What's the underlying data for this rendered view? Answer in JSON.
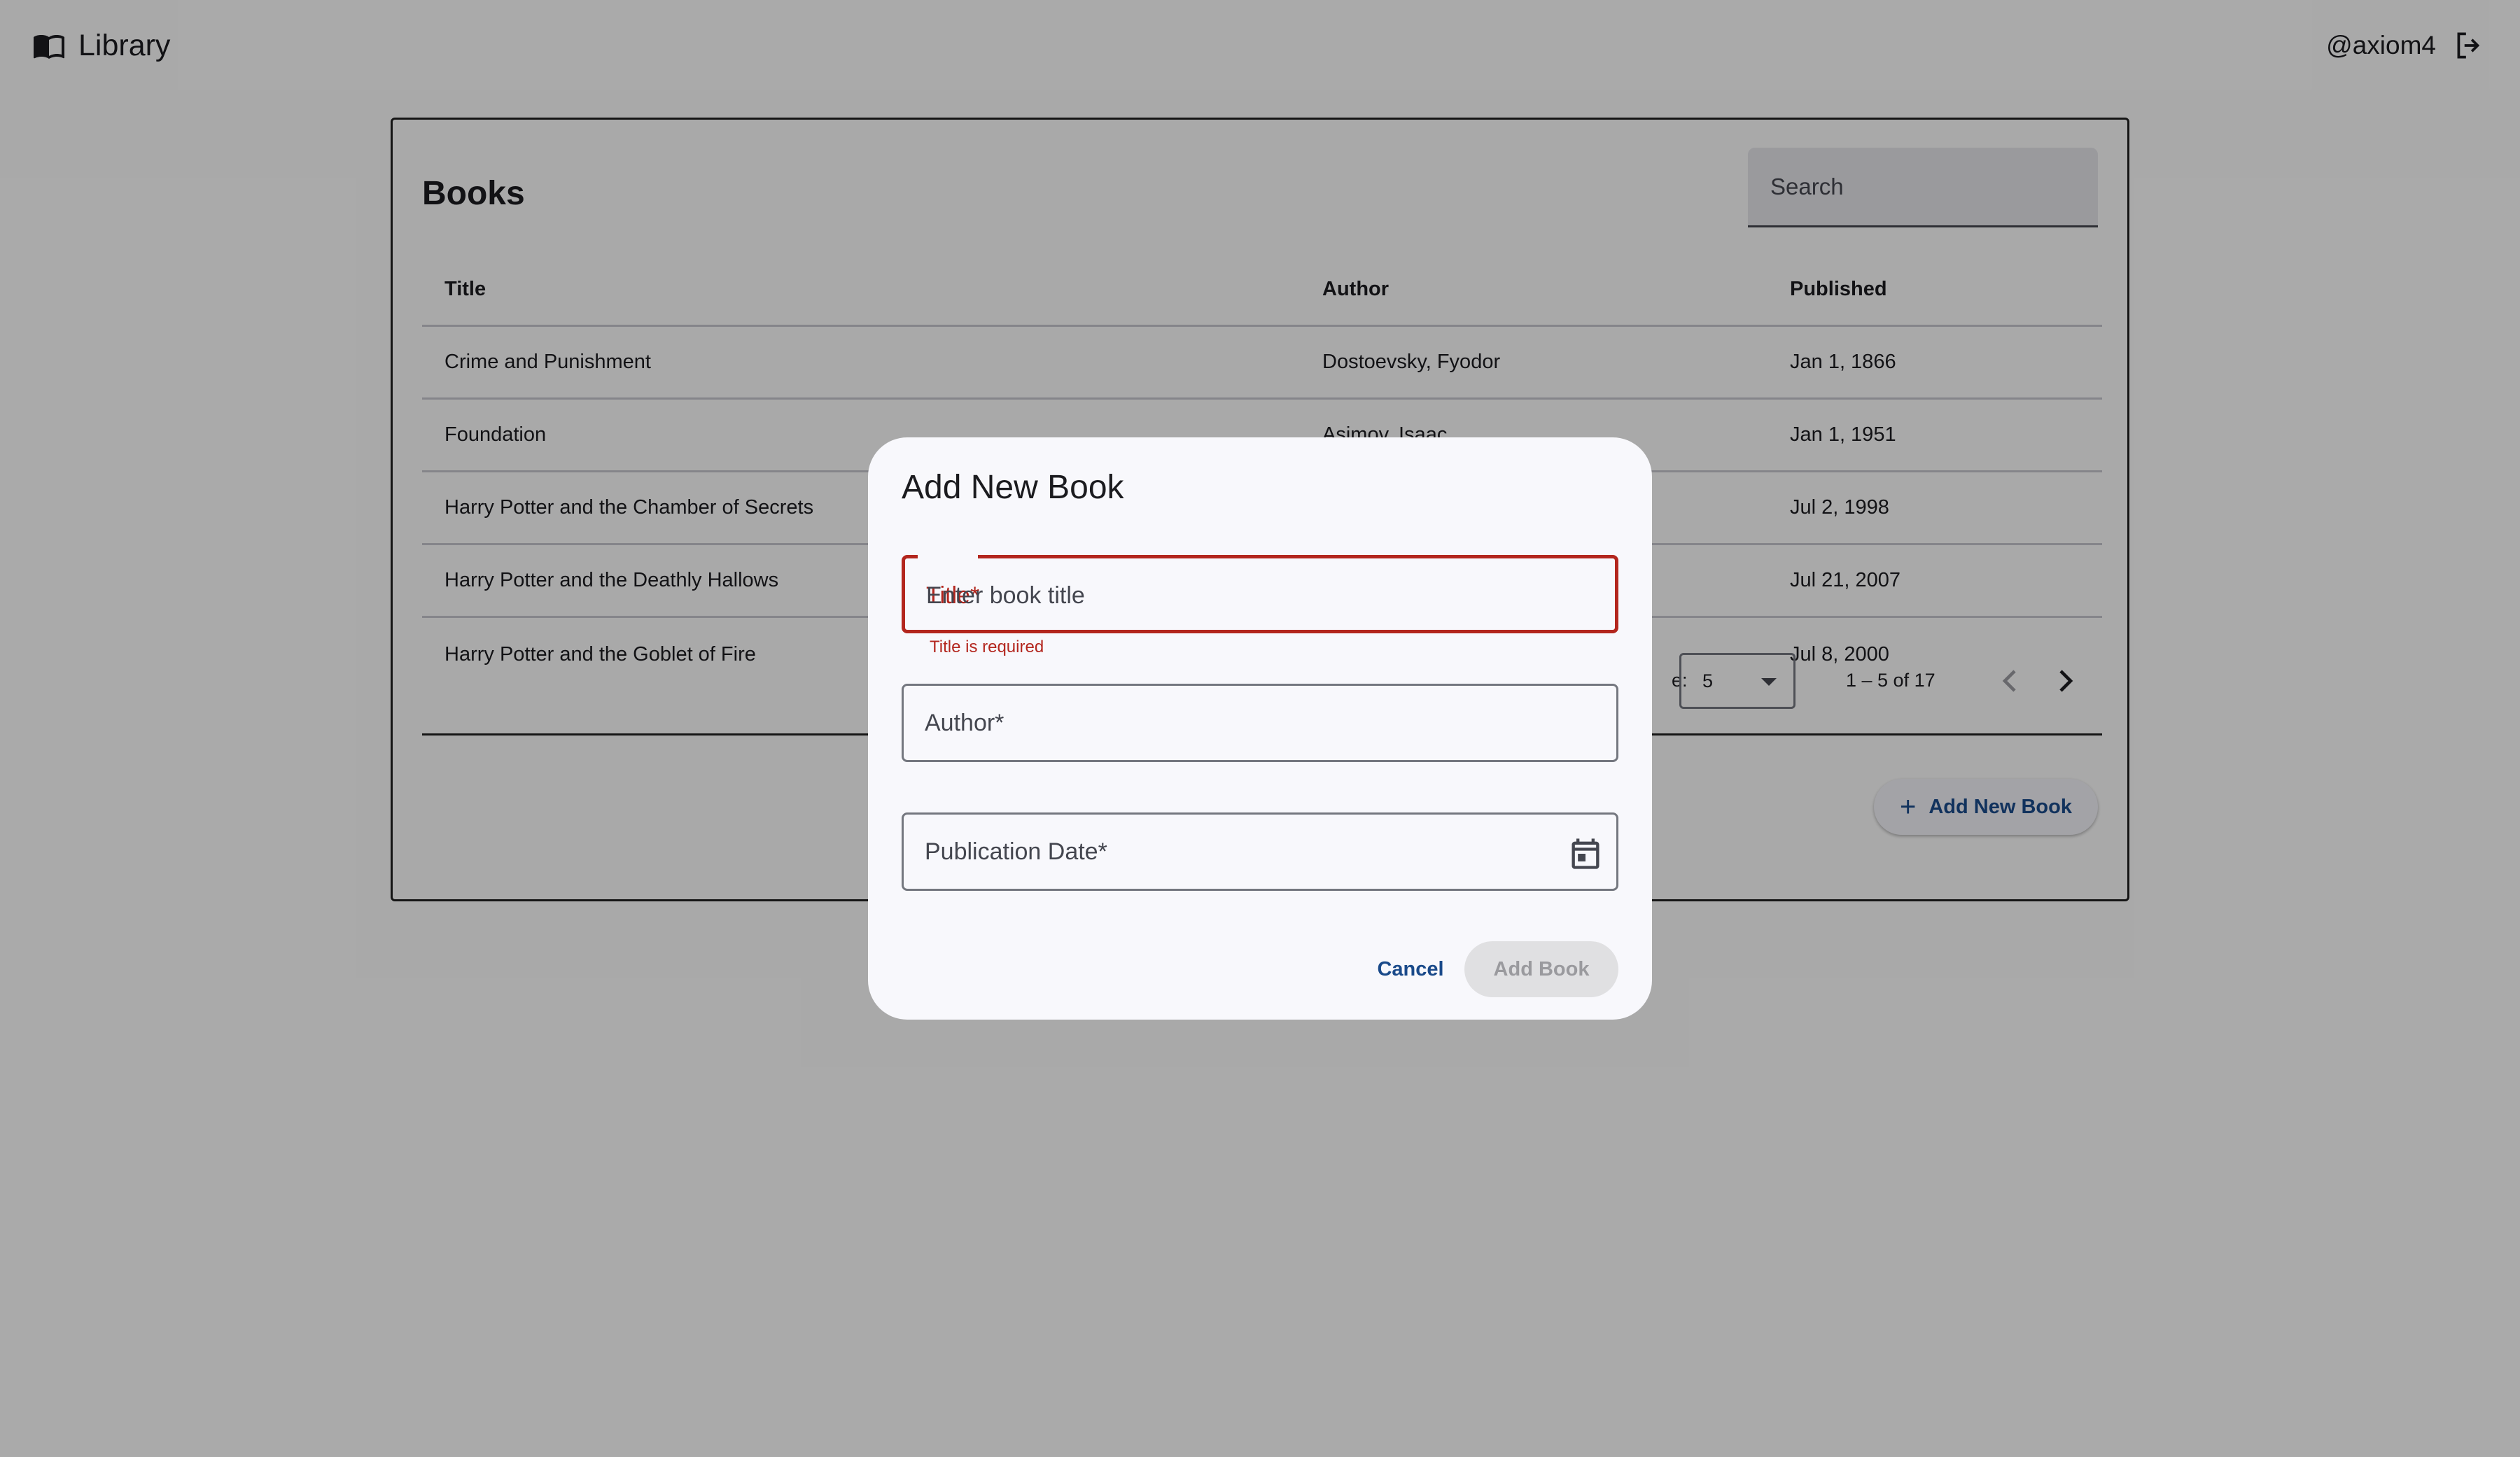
{
  "header": {
    "app_title": "Library",
    "username": "@axiom4"
  },
  "books": {
    "title": "Books",
    "search_placeholder": "Search",
    "columns": [
      "Title",
      "Author",
      "Published"
    ],
    "rows": [
      {
        "title": "Crime and Punishment",
        "author": "Dostoevsky, Fyodor",
        "published": "Jan 1, 1866"
      },
      {
        "title": "Foundation",
        "author": "Asimov, Isaac",
        "published": "Jan 1, 1951"
      },
      {
        "title": "Harry Potter and the Chamber of Secrets",
        "author": "",
        "published": "Jul 2, 1998"
      },
      {
        "title": "Harry Potter and the Deathly Hallows",
        "author": "",
        "published": "Jul 21, 2007"
      },
      {
        "title": "Harry Potter and the Goblet of Fire",
        "author": "",
        "published": "Jul 8, 2000"
      }
    ],
    "paginator": {
      "label_suffix": "e:",
      "page_size": "5",
      "range": "1 – 5 of 17"
    },
    "add_button_label": "Add New Book"
  },
  "dialog": {
    "title": "Add New Book",
    "title_field": {
      "label": "Title*",
      "placeholder": "Enter book title",
      "error": "Title is required"
    },
    "author_field": {
      "label": "Author*"
    },
    "date_field": {
      "label": "Publication Date*"
    },
    "cancel_label": "Cancel",
    "submit_label": "Add Book"
  },
  "colors": {
    "primary": "#1a4a8a",
    "error": "#b3261e",
    "overlay": "#000000"
  }
}
